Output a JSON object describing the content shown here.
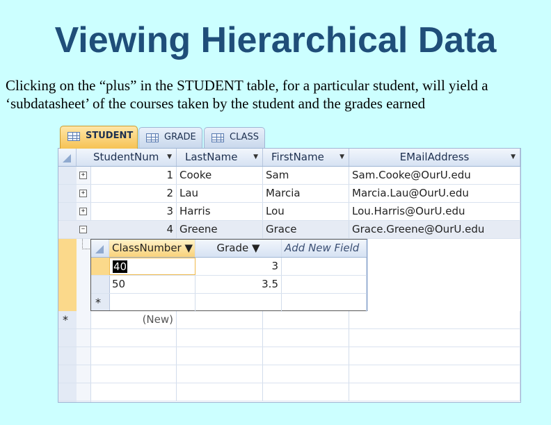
{
  "slide": {
    "title": "Viewing Hierarchical Data",
    "caption": "Clicking on the “plus” in the STUDENT table, for a particular student, will yield a ‘subdatasheet’ of the courses taken by the student and the grades earned"
  },
  "tabs": [
    {
      "label": "STUDENT",
      "active": true
    },
    {
      "label": "GRADE",
      "active": false
    },
    {
      "label": "CLASS",
      "active": false
    }
  ],
  "student_table": {
    "columns": [
      "StudentNum",
      "LastName",
      "FirstName",
      "EMailAddress"
    ],
    "rows": [
      {
        "student_num": "1",
        "last_name": "Cooke",
        "first_name": "Sam",
        "email": "Sam.Cooke@OurU.edu",
        "expander": "+"
      },
      {
        "student_num": "2",
        "last_name": "Lau",
        "first_name": "Marcia",
        "email": "Marcia.Lau@OurU.edu",
        "expander": "+"
      },
      {
        "student_num": "3",
        "last_name": "Harris",
        "first_name": "Lou",
        "email": "Lou.Harris@OurU.edu",
        "expander": "+"
      },
      {
        "student_num": "4",
        "last_name": "Greene",
        "first_name": "Grace",
        "email": "Grace.Greene@OurU.edu",
        "expander": "−"
      }
    ],
    "new_row_marker": "*",
    "new_row_label": "(New)"
  },
  "subdatasheet": {
    "columns": [
      "ClassNumber",
      "Grade",
      "Add New Field"
    ],
    "rows": [
      {
        "class_number": "40",
        "grade": "3"
      },
      {
        "class_number": "50",
        "grade": "3.5"
      }
    ],
    "new_row_marker": "*"
  },
  "colors": {
    "background": "#ccffff",
    "title": "#1f4e79",
    "active_tab": "#f6c254",
    "selector_highlight": "#fbd98b"
  },
  "icons": {
    "tab_icon": "table-icon",
    "dropdown": "dropdown-arrow-icon",
    "expand": "expand-plus-icon",
    "collapse": "collapse-minus-icon",
    "new_record": "new-record-asterisk-icon"
  }
}
